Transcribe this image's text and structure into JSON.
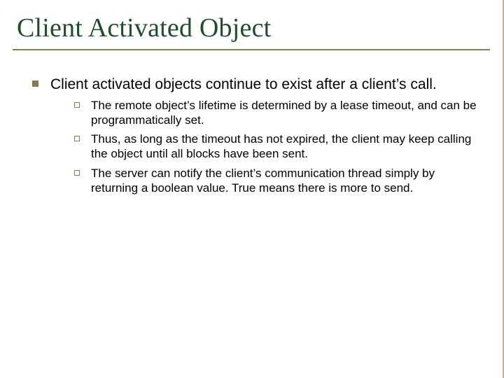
{
  "slide": {
    "title": "Client Activated Object",
    "main": {
      "text": "Client activated objects continue to exist after a client’s call.",
      "subpoints": [
        "The remote object’s lifetime is determined by a lease timeout, and can be programmatically set.",
        "Thus, as long as the timeout has not expired, the client may keep calling the object until all blocks have been sent.",
        "The server can notify the client’s communication thread simply by returning a boolean value.  True means there is more to send."
      ]
    }
  }
}
